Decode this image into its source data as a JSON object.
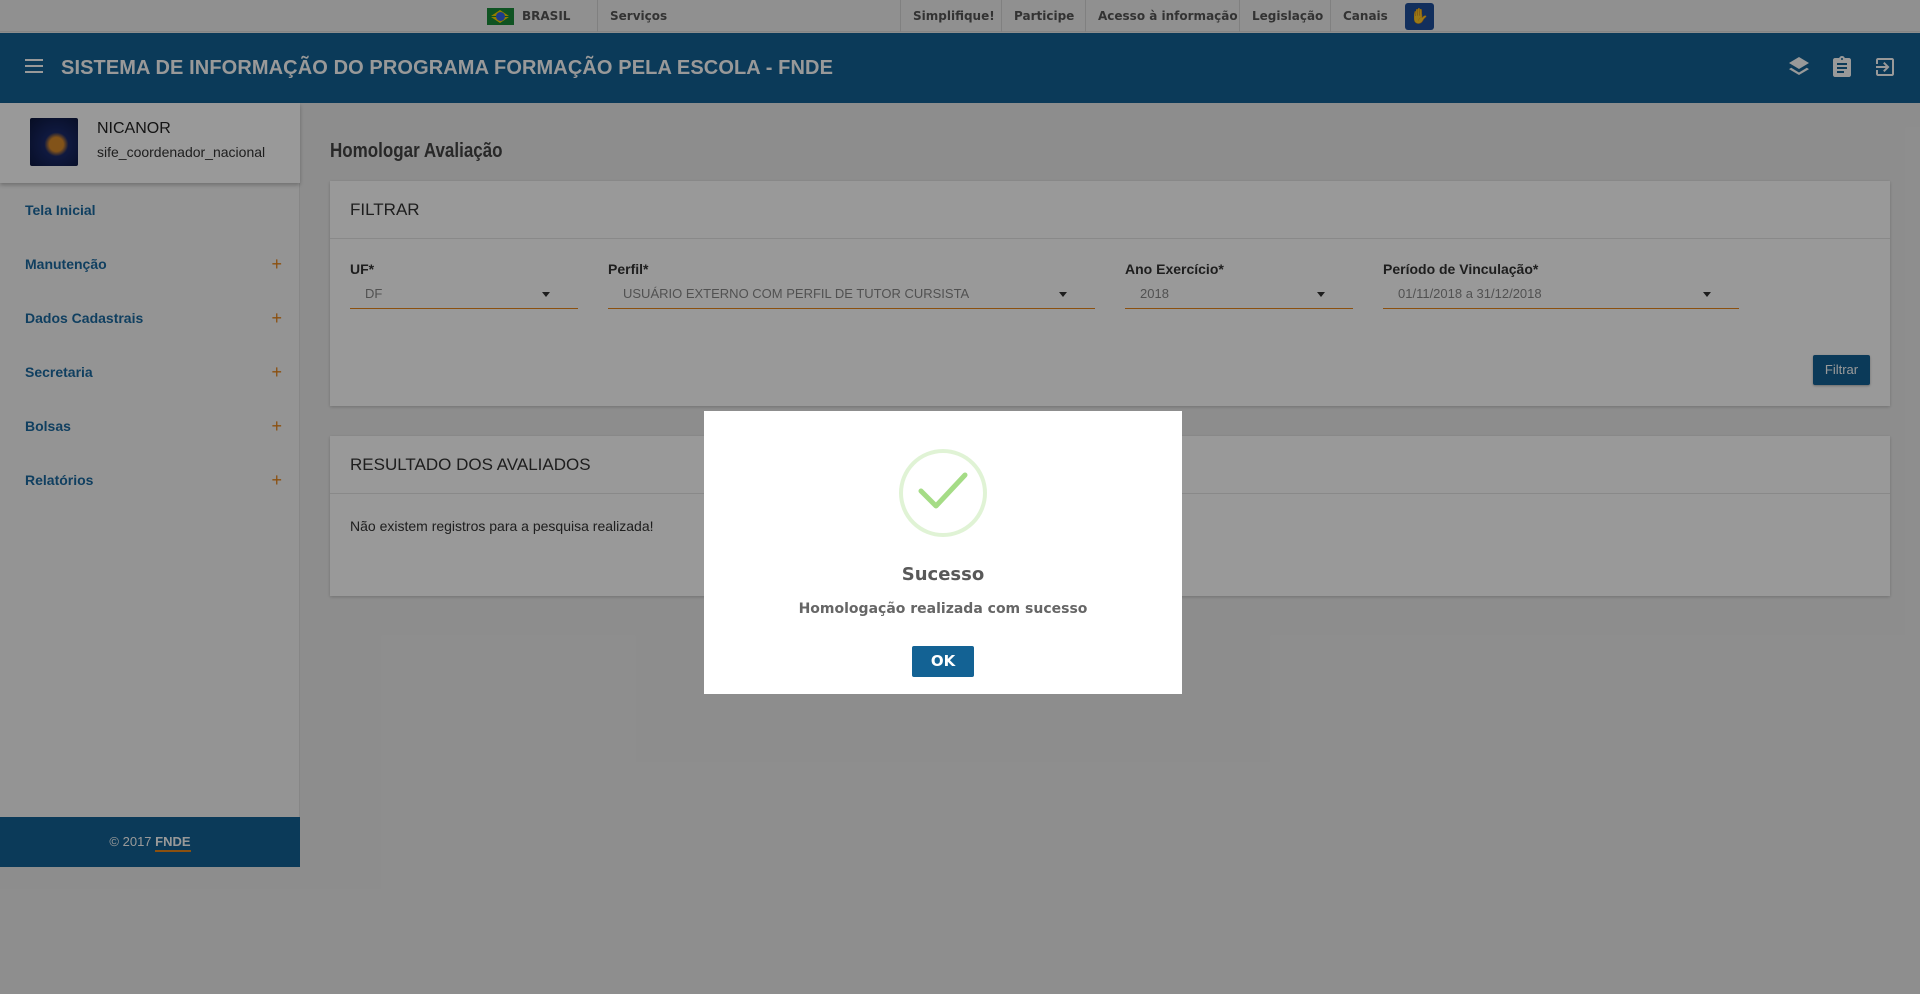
{
  "govbar": {
    "country": "BRASIL",
    "services": "Serviços",
    "links": [
      "Simplifique!",
      "Participe",
      "Acesso à informação",
      "Legislação",
      "Canais"
    ]
  },
  "header": {
    "title": "SISTEMA DE INFORMAÇÃO DO PROGRAMA FORMAÇÃO PELA ESCOLA - FNDE"
  },
  "user": {
    "name": "NICANOR",
    "role": "sife_coordenador_nacional"
  },
  "sidebar": {
    "items": [
      {
        "label": "Tela Inicial",
        "expandable": false
      },
      {
        "label": "Manutenção",
        "expandable": true
      },
      {
        "label": "Dados Cadastrais",
        "expandable": true
      },
      {
        "label": "Secretaria",
        "expandable": true
      },
      {
        "label": "Bolsas",
        "expandable": true
      },
      {
        "label": "Relatórios",
        "expandable": true
      }
    ],
    "plus": "+",
    "footer_text": "© 2017",
    "footer_link": "FNDE"
  },
  "page": {
    "title": "Homologar Avaliação",
    "filter": {
      "heading": "FILTRAR",
      "uf_label": "UF*",
      "uf_value": "DF",
      "perfil_label": "Perfil*",
      "perfil_value": "USUÁRIO EXTERNO COM PERFIL DE TUTOR CURSISTA",
      "ano_label": "Ano Exercício*",
      "ano_value": "2018",
      "periodo_label": "Período de Vinculação*",
      "periodo_value": "01/11/2018 a 31/12/2018",
      "button": "Filtrar"
    },
    "results": {
      "heading": "RESULTADO DOS AVALIADOS",
      "empty": "Não existem registros para a pesquisa realizada!"
    }
  },
  "modal": {
    "title": "Sucesso",
    "message": "Homologação realizada com sucesso",
    "ok": "OK",
    "icon": "check-icon",
    "icon_color": "#a5dc86"
  },
  "colors": {
    "brand": "#136294",
    "accent": "#e8851a"
  }
}
